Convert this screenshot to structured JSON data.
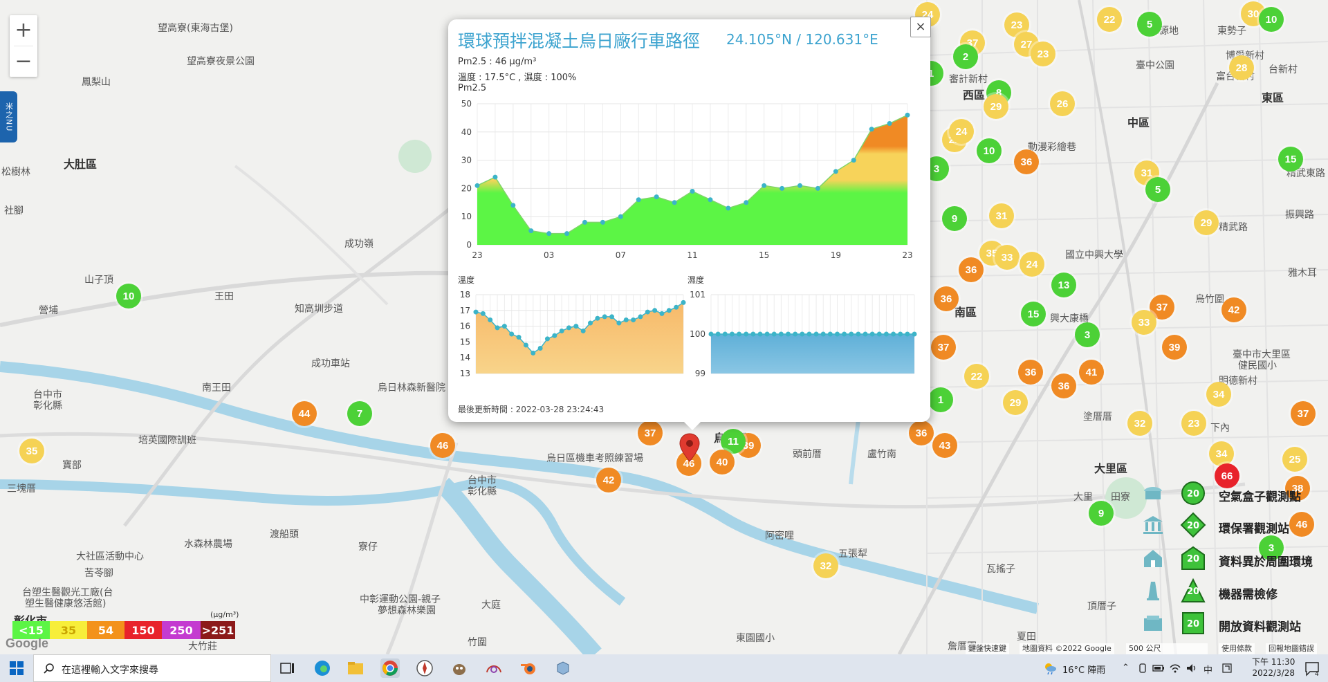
{
  "map": {
    "zoom_in": "+",
    "zoom_out": "−",
    "side_tab": "米之NU",
    "places": [
      {
        "t": "望高寮(東海古堡)",
        "x": 228,
        "y": 30
      },
      {
        "t": "望高寮夜景公園",
        "x": 270,
        "y": 78
      },
      {
        "t": "鳳梨山",
        "x": 118,
        "y": 108
      },
      {
        "t": "大肚區",
        "x": 92,
        "y": 224,
        "big": true
      },
      {
        "t": "松樹林",
        "x": 2,
        "y": 238
      },
      {
        "t": "社腳",
        "x": 6,
        "y": 294
      },
      {
        "t": "成功嶺",
        "x": 498,
        "y": 342
      },
      {
        "t": "山子頂",
        "x": 122,
        "y": 394
      },
      {
        "t": "王田",
        "x": 310,
        "y": 418
      },
      {
        "t": "營埔",
        "x": 56,
        "y": 438
      },
      {
        "t": "知高圳步道",
        "x": 426,
        "y": 436
      },
      {
        "t": "成功車站",
        "x": 450,
        "y": 515
      },
      {
        "t": "南王田",
        "x": 292,
        "y": 550
      },
      {
        "t": "烏日林森新醫院",
        "x": 546,
        "y": 550
      },
      {
        "t": "台中市",
        "x": 48,
        "y": 560
      },
      {
        "t": "彰化縣",
        "x": 48,
        "y": 576
      },
      {
        "t": "培英國際訓班",
        "x": 200,
        "y": 626
      },
      {
        "t": "寶部",
        "x": 90,
        "y": 662
      },
      {
        "t": "三塊厝",
        "x": 10,
        "y": 696
      },
      {
        "t": "渡船頭",
        "x": 390,
        "y": 762
      },
      {
        "t": "水森林農場",
        "x": 266,
        "y": 776
      },
      {
        "t": "寮仔",
        "x": 518,
        "y": 780
      },
      {
        "t": "大社區活動中心",
        "x": 110,
        "y": 794
      },
      {
        "t": "苦苓腳",
        "x": 122,
        "y": 818
      },
      {
        "t": "台塑生醫觀光工廠(台",
        "x": 32,
        "y": 846
      },
      {
        "t": "塑生醫健康悠活館)",
        "x": 36,
        "y": 862
      },
      {
        "t": "大庭",
        "x": 696,
        "y": 864
      },
      {
        "t": "中彰運動公園-親子",
        "x": 520,
        "y": 856
      },
      {
        "t": "夢想森林樂園",
        "x": 546,
        "y": 872
      },
      {
        "t": "彰化市",
        "x": 20,
        "y": 884,
        "big": true
      },
      {
        "t": "大竹莊",
        "x": 272,
        "y": 924
      },
      {
        "t": "竹圍",
        "x": 676,
        "y": 918
      },
      {
        "t": "烏日區機車考照練習場",
        "x": 790,
        "y": 652
      },
      {
        "t": "台中市",
        "x": 676,
        "y": 684
      },
      {
        "t": "彰化縣",
        "x": 676,
        "y": 700
      },
      {
        "t": "烏日區",
        "x": 1032,
        "y": 620,
        "big": true
      },
      {
        "t": "頭前厝",
        "x": 1146,
        "y": 646
      },
      {
        "t": "盧竹南",
        "x": 1254,
        "y": 646
      },
      {
        "t": "阿密哩",
        "x": 1106,
        "y": 764
      },
      {
        "t": "五張犁",
        "x": 1212,
        "y": 790
      },
      {
        "t": "瓦搖子",
        "x": 1426,
        "y": 812
      },
      {
        "t": "頂厝子",
        "x": 1572,
        "y": 866
      },
      {
        "t": "詹厝園",
        "x": 1370,
        "y": 924
      },
      {
        "t": "夏田",
        "x": 1470,
        "y": 910
      },
      {
        "t": "東園國小",
        "x": 1064,
        "y": 912
      },
      {
        "t": "西區",
        "x": 1392,
        "y": 124,
        "big": true
      },
      {
        "t": "審計新村",
        "x": 1372,
        "y": 104
      },
      {
        "t": "中區",
        "x": 1630,
        "y": 164,
        "big": true
      },
      {
        "t": "東區",
        "x": 1824,
        "y": 128,
        "big": true
      },
      {
        "t": "水源地",
        "x": 1662,
        "y": 34
      },
      {
        "t": "東勢子",
        "x": 1760,
        "y": 34
      },
      {
        "t": "博愛新村",
        "x": 1772,
        "y": 70
      },
      {
        "t": "富台新村",
        "x": 1758,
        "y": 100
      },
      {
        "t": "台新村",
        "x": 1834,
        "y": 90
      },
      {
        "t": "臺中公園",
        "x": 1642,
        "y": 84
      },
      {
        "t": "動漫彩繪巷",
        "x": 1486,
        "y": 202
      },
      {
        "t": "國立中興大學",
        "x": 1540,
        "y": 358
      },
      {
        "t": "南區",
        "x": 1380,
        "y": 438,
        "big": true
      },
      {
        "t": "興大康橋",
        "x": 1518,
        "y": 450
      },
      {
        "t": "烏竹圍",
        "x": 1728,
        "y": 422
      },
      {
        "t": "雅木耳",
        "x": 1862,
        "y": 384
      },
      {
        "t": "明德新村",
        "x": 1762,
        "y": 540
      },
      {
        "t": "臺中市大里區",
        "x": 1782,
        "y": 502
      },
      {
        "t": "健民國小",
        "x": 1790,
        "y": 518
      },
      {
        "t": "塗厝厝",
        "x": 1566,
        "y": 592
      },
      {
        "t": "下內",
        "x": 1750,
        "y": 608
      },
      {
        "t": "大里區",
        "x": 1582,
        "y": 664,
        "big": true
      },
      {
        "t": "大里",
        "x": 1552,
        "y": 708
      },
      {
        "t": "田寮",
        "x": 1606,
        "y": 708
      },
      {
        "t": "振興路",
        "x": 1858,
        "y": 300
      },
      {
        "t": "精武路",
        "x": 1762,
        "y": 318
      },
      {
        "t": "精武東路",
        "x": 1860,
        "y": 240
      }
    ],
    "markers": [
      {
        "v": "24",
        "x": 1341,
        "y": 21,
        "c": "#f5d255"
      },
      {
        "v": "23",
        "x": 1470,
        "y": 36,
        "c": "#f5d255"
      },
      {
        "v": "22",
        "x": 1604,
        "y": 28,
        "c": "#f5d255"
      },
      {
        "v": "5",
        "x": 1662,
        "y": 35,
        "c": "#4cd137"
      },
      {
        "v": "30",
        "x": 1812,
        "y": 20,
        "c": "#f5d255"
      },
      {
        "v": "10",
        "x": 1838,
        "y": 28,
        "c": "#4cd137"
      },
      {
        "v": "37",
        "x": 1406,
        "y": 62,
        "c": "#f5d255"
      },
      {
        "v": "27",
        "x": 1484,
        "y": 64,
        "c": "#f5d255"
      },
      {
        "v": "23",
        "x": 1508,
        "y": 78,
        "c": "#f5d255"
      },
      {
        "v": "2",
        "x": 1396,
        "y": 82,
        "c": "#4cd137"
      },
      {
        "v": "28",
        "x": 1795,
        "y": 98,
        "c": "#f5d255"
      },
      {
        "v": "1",
        "x": 1346,
        "y": 106,
        "c": "#4cd137"
      },
      {
        "v": "8",
        "x": 1444,
        "y": 134,
        "c": "#4cd137"
      },
      {
        "v": "29",
        "x": 1440,
        "y": 154,
        "c": "#f5d255"
      },
      {
        "v": "26",
        "x": 1536,
        "y": 150,
        "c": "#f5d255"
      },
      {
        "v": "22",
        "x": 1380,
        "y": 202,
        "c": "#f5d255"
      },
      {
        "v": "24",
        "x": 1390,
        "y": 190,
        "c": "#f5d255"
      },
      {
        "v": "10",
        "x": 1430,
        "y": 218,
        "c": "#4cd137"
      },
      {
        "v": "36",
        "x": 1484,
        "y": 234,
        "c": "#f08a24"
      },
      {
        "v": "15",
        "x": 1866,
        "y": 230,
        "c": "#4cd137"
      },
      {
        "v": "3",
        "x": 1354,
        "y": 244,
        "c": "#4cd137"
      },
      {
        "v": "31",
        "x": 1658,
        "y": 250,
        "c": "#f5d255"
      },
      {
        "v": "5",
        "x": 1674,
        "y": 274,
        "c": "#4cd137"
      },
      {
        "v": "9",
        "x": 1380,
        "y": 316,
        "c": "#4cd137"
      },
      {
        "v": "31",
        "x": 1448,
        "y": 312,
        "c": "#f5d255"
      },
      {
        "v": "29",
        "x": 1744,
        "y": 322,
        "c": "#f5d255"
      },
      {
        "v": "35",
        "x": 1434,
        "y": 366,
        "c": "#f5d255"
      },
      {
        "v": "33",
        "x": 1456,
        "y": 372,
        "c": "#f5d255"
      },
      {
        "v": "24",
        "x": 1492,
        "y": 382,
        "c": "#f5d255"
      },
      {
        "v": "36",
        "x": 1404,
        "y": 390,
        "c": "#f08a24"
      },
      {
        "v": "13",
        "x": 1538,
        "y": 412,
        "c": "#4cd137"
      },
      {
        "v": "36",
        "x": 1368,
        "y": 432,
        "c": "#f08a24"
      },
      {
        "v": "15",
        "x": 1494,
        "y": 454,
        "c": "#4cd137"
      },
      {
        "v": "37",
        "x": 1680,
        "y": 444,
        "c": "#f08a24"
      },
      {
        "v": "33",
        "x": 1654,
        "y": 466,
        "c": "#f5d255"
      },
      {
        "v": "42",
        "x": 1784,
        "y": 448,
        "c": "#f08a24"
      },
      {
        "v": "3",
        "x": 1572,
        "y": 484,
        "c": "#4cd137"
      },
      {
        "v": "37",
        "x": 1364,
        "y": 502,
        "c": "#f08a24"
      },
      {
        "v": "39",
        "x": 1698,
        "y": 502,
        "c": "#f08a24"
      },
      {
        "v": "22",
        "x": 1412,
        "y": 544,
        "c": "#f5d255"
      },
      {
        "v": "36",
        "x": 1490,
        "y": 538,
        "c": "#f08a24"
      },
      {
        "v": "41",
        "x": 1578,
        "y": 538,
        "c": "#f08a24"
      },
      {
        "v": "36",
        "x": 1538,
        "y": 558,
        "c": "#f08a24"
      },
      {
        "v": "1",
        "x": 1360,
        "y": 578,
        "c": "#4cd137"
      },
      {
        "v": "29",
        "x": 1468,
        "y": 582,
        "c": "#f5d255"
      },
      {
        "v": "34",
        "x": 1762,
        "y": 570,
        "c": "#f5d255"
      },
      {
        "v": "37",
        "x": 1884,
        "y": 598,
        "c": "#f08a24"
      },
      {
        "v": "32",
        "x": 1648,
        "y": 612,
        "c": "#f5d255"
      },
      {
        "v": "23",
        "x": 1726,
        "y": 612,
        "c": "#f5d255"
      },
      {
        "v": "36",
        "x": 1332,
        "y": 626,
        "c": "#f08a24"
      },
      {
        "v": "43",
        "x": 1366,
        "y": 644,
        "c": "#f08a24"
      },
      {
        "v": "34",
        "x": 1766,
        "y": 656,
        "c": "#f5d255"
      },
      {
        "v": "25",
        "x": 1872,
        "y": 664,
        "c": "#f5d255"
      },
      {
        "v": "66",
        "x": 1774,
        "y": 688,
        "c": "#e8232b"
      },
      {
        "v": "38",
        "x": 1876,
        "y": 706,
        "c": "#f08a24"
      },
      {
        "v": "46",
        "x": 1882,
        "y": 758,
        "c": "#f08a24"
      },
      {
        "v": "32",
        "x": 1194,
        "y": 818,
        "c": "#f5d255"
      },
      {
        "v": "10",
        "x": 186,
        "y": 428,
        "c": "#4cd137"
      },
      {
        "v": "44",
        "x": 440,
        "y": 598,
        "c": "#f08a24"
      },
      {
        "v": "7",
        "x": 520,
        "y": 598,
        "c": "#4cd137"
      },
      {
        "v": "35",
        "x": 46,
        "y": 652,
        "c": "#f5d255"
      },
      {
        "v": "46",
        "x": 640,
        "y": 644,
        "c": "#f08a24"
      },
      {
        "v": "37",
        "x": 940,
        "y": 626,
        "c": "#f08a24"
      },
      {
        "v": "39",
        "x": 1082,
        "y": 644,
        "c": "#f08a24"
      },
      {
        "v": "11",
        "x": 1060,
        "y": 638,
        "c": "#4cd137"
      },
      {
        "v": "40",
        "x": 1044,
        "y": 668,
        "c": "#f08a24"
      },
      {
        "v": "46",
        "x": 996,
        "y": 670,
        "c": "#f08a24"
      },
      {
        "v": "42",
        "x": 880,
        "y": 694,
        "c": "#f08a24"
      },
      {
        "v": "9",
        "x": 1592,
        "y": 742,
        "c": "#4cd137"
      },
      {
        "v": "3",
        "x": 1838,
        "y": 792,
        "c": "#4cd137"
      }
    ]
  },
  "popup": {
    "close": "×",
    "title": "環球預拌混凝土烏日廠行車路徑",
    "coord": "24.105°N / 120.631°E",
    "pm25_line": "Pm2.5 : 46 μg/m³",
    "weather_line": "溫度 : 17.5°C , 濕度 : 100%",
    "updated": "最後更新時間 : 2022-03-28 23:24:43"
  },
  "chart_data": [
    {
      "type": "area",
      "title": "Pm2.5",
      "categories": [
        "23",
        "00",
        "01",
        "02",
        "03",
        "04",
        "05",
        "06",
        "07",
        "08",
        "09",
        "10",
        "11",
        "12",
        "13",
        "14",
        "15",
        "16",
        "17",
        "18",
        "19",
        "20",
        "21",
        "22",
        "23"
      ],
      "x_ticks": [
        "23",
        "03",
        "07",
        "11",
        "15",
        "19",
        "23"
      ],
      "values": [
        21,
        24,
        14,
        5,
        4,
        4,
        8,
        8,
        10,
        16,
        17,
        15,
        19,
        16,
        13,
        15,
        21,
        20,
        21,
        20,
        26,
        30,
        41,
        43,
        46
      ],
      "ylim": [
        0,
        50
      ],
      "y_ticks": [
        0,
        10,
        20,
        30,
        40,
        50
      ],
      "grid": true,
      "colors": {
        "low": "#5cf545",
        "mid": "#f7d35a",
        "high": "#f08a24",
        "point": "#3cb4c8"
      }
    },
    {
      "type": "area",
      "title": "溫度",
      "values": [
        16.9,
        16.8,
        16.4,
        15.9,
        16.0,
        15.5,
        15.3,
        14.8,
        14.3,
        14.6,
        15.2,
        15.4,
        15.7,
        15.9,
        16.0,
        15.7,
        16.2,
        16.5,
        16.6,
        16.6,
        16.2,
        16.4,
        16.4,
        16.6,
        16.9,
        17.0,
        16.8,
        17.0,
        17.2,
        17.5
      ],
      "ylim": [
        13,
        18
      ],
      "y_ticks": [
        13,
        14,
        15,
        16,
        17,
        18
      ],
      "grid": true,
      "colors": {
        "fill": "#f5c77a",
        "point": "#3cb4c8"
      }
    },
    {
      "type": "area",
      "title": "濕度",
      "values": [
        100,
        100,
        100,
        100,
        100,
        100,
        100,
        100,
        100,
        100,
        100,
        100,
        100,
        100,
        100,
        100,
        100,
        100,
        100,
        100,
        100,
        100,
        100,
        100,
        100,
        100,
        100,
        100,
        100,
        100
      ],
      "ylim": [
        99,
        101
      ],
      "y_ticks": [
        99,
        100,
        101
      ],
      "grid": true,
      "colors": {
        "fill": "#6fb7dc",
        "point": "#3cb4c8"
      }
    }
  ],
  "legend": {
    "badge_value": "20",
    "items": [
      {
        "label": "空氣盒子觀測點",
        "icon": "cloud-box-icon"
      },
      {
        "label": "環保署觀測站",
        "icon": "government-building-icon"
      },
      {
        "label": "資料異於周圍環境",
        "icon": "house-icon"
      },
      {
        "label": "機器需檢修",
        "icon": "tower-icon"
      },
      {
        "label": "開放資料觀測站",
        "icon": "open-data-icon"
      }
    ]
  },
  "aqi_scale": {
    "unit": "(μg/m³)",
    "cells": [
      {
        "label": "<15",
        "color": "#5cf545",
        "text": "#ffffff"
      },
      {
        "label": "35",
        "color": "#f7ee3a",
        "text": "#c9a400"
      },
      {
        "label": "54",
        "color": "#f3921b",
        "text": "#ffffff"
      },
      {
        "label": "150",
        "color": "#e8232b",
        "text": "#ffffff"
      },
      {
        "label": "250",
        "color": "#c43ad0",
        "text": "#ffffff"
      },
      {
        "label": ">251",
        "color": "#8c1a1a",
        "text": "#ffffff"
      }
    ]
  },
  "attribution": {
    "google": "Google",
    "shortcuts": "鍵盤快速鍵",
    "mapdata": "地圖資料 ©2022 Google",
    "scale": "500 公尺",
    "terms": "使用條款",
    "report": "回報地圖錯誤"
  },
  "taskbar": {
    "search_placeholder": "在這裡輸入文字來搜尋",
    "weather": "16°C  陣雨",
    "ime": "中",
    "time": "下午 11:30",
    "date": "2022/3/28",
    "notifications": "4"
  }
}
